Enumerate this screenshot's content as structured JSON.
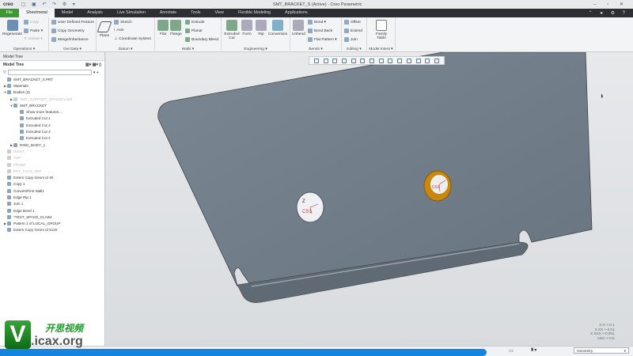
{
  "titlebar": {
    "logo": "creo",
    "title": "SMT_BRACKET_S (Active) - Creo Parametric"
  },
  "tabs": [
    "File",
    "Sheetmetal",
    "Model",
    "Analysis",
    "Live Simulation",
    "Annotate",
    "Tools",
    "View",
    "Flexible Modeling",
    "Applications"
  ],
  "ribbon": {
    "operations": {
      "label": "Operations ▾",
      "regenerate": "Regenerate",
      "copy": "Copy",
      "paste": "Paste ▾",
      "delete": "Delete ▾"
    },
    "getdata": {
      "label": "Get Data ▾",
      "udf": "User Defined Feature",
      "copygeom": "Copy Geometry",
      "merge": "Merge/Inheritance"
    },
    "datum": {
      "label": "Datum ▾",
      "plane": "Plane",
      "sketch": "Sketch",
      "axis": "Axis",
      "csys": "Coordinate System"
    },
    "walls": {
      "label": "Walls ▾",
      "flat": "Flat",
      "flange": "Flange",
      "extrude": "Extrude",
      "planar": "Planar",
      "boundary": "Boundary Blend"
    },
    "engineering": {
      "label": "Engineering ▾",
      "cut": "Extruded Cut",
      "form": "Form",
      "rip": "Rip",
      "conversion": "Conversion"
    },
    "bends": {
      "label": "Bends ▾",
      "unbend": "Unbend",
      "bend": "Bend ▾",
      "bendback": "Bend Back",
      "flatpattern": "Flat Pattern ▾"
    },
    "editing": {
      "label": "Editing ▾",
      "offset": "Offset",
      "extend": "Extend",
      "join": "Join"
    },
    "intent": {
      "label": "Model Intent ▾",
      "family": "Family Table"
    }
  },
  "tree": {
    "tab": "Model Tree",
    "title": "Model Tree",
    "filter_value": "",
    "nodes": [
      {
        "label": "SMT_BRACKET_S.PRT",
        "toggle": "",
        "level": 0,
        "grey": false
      },
      {
        "label": "Materials",
        "toggle": "▶",
        "level": 0,
        "grey": false
      },
      {
        "label": "Bodies (3)",
        "toggle": "▼",
        "level": 0,
        "grey": false
      },
      {
        "label": "SMT_SUPPORT_SPACECLAIM",
        "toggle": "▶",
        "level": 1,
        "grey": true
      },
      {
        "label": "SMT_BRACKET",
        "toggle": "▼",
        "level": 1,
        "grey": false
      },
      {
        "label": "Show more features...",
        "toggle": "",
        "level": 2,
        "grey": false
      },
      {
        "label": "Extruded Cut 1",
        "toggle": "",
        "level": 2,
        "grey": false
      },
      {
        "label": "Extruded Cut 2",
        "toggle": "",
        "level": 2,
        "grey": false
      },
      {
        "label": "Extruded Cut 3",
        "toggle": "",
        "level": 2,
        "grey": false
      },
      {
        "label": "Extruded Cut 4",
        "toggle": "",
        "level": 2,
        "grey": false
      },
      {
        "label": "RING_BODY_1",
        "toggle": "▶",
        "level": 1,
        "grey": false
      },
      {
        "label": "RIGHT",
        "toggle": "",
        "level": 0,
        "grey": true
      },
      {
        "label": "TOP",
        "toggle": "",
        "level": 0,
        "grey": true
      },
      {
        "label": "FRONT",
        "toggle": "",
        "level": 0,
        "grey": true
      },
      {
        "label": "PRT_CSYS_DEF",
        "toggle": "",
        "level": 0,
        "grey": true
      },
      {
        "label": "Extern Copy Geom id 40",
        "toggle": "",
        "level": 0,
        "grey": false
      },
      {
        "label": "Copy 1",
        "toggle": "",
        "level": 0,
        "grey": false
      },
      {
        "label": "Convert/First Wall1",
        "toggle": "",
        "level": 0,
        "grey": false
      },
      {
        "label": "Edge Rip 1",
        "toggle": "",
        "level": 0,
        "grey": false
      },
      {
        "label": "Join 1",
        "toggle": "",
        "level": 0,
        "grey": false
      },
      {
        "label": "Edge Bend 1",
        "toggle": "",
        "level": 0,
        "grey": false
      },
      {
        "label": "*TEST_SPACE_CLAIM",
        "toggle": "",
        "level": 0,
        "grey": false
      },
      {
        "label": "Pattern 1 of LOCAL_GROUP",
        "toggle": "▶",
        "level": 0,
        "grey": false
      },
      {
        "label": "Extern Copy Geom id 5120",
        "toggle": "",
        "level": 0,
        "grey": false
      }
    ]
  },
  "viewport": {
    "csys1": "CS1",
    "csys2": "CS1",
    "axis": "Z",
    "part_color": "#6f7c88",
    "highlight_color": "#c8870e"
  },
  "tolerance": [
    "X.X +-0.1",
    "X.XX +-0.01",
    "X.XXX +-0.001",
    "ANG +-0.5"
  ],
  "status": {
    "filter": "Geometry",
    "progress_color": "#1583e0"
  },
  "watermark": {
    "cn": "开思视频",
    "en": ".icax.org",
    "letter": "V"
  }
}
